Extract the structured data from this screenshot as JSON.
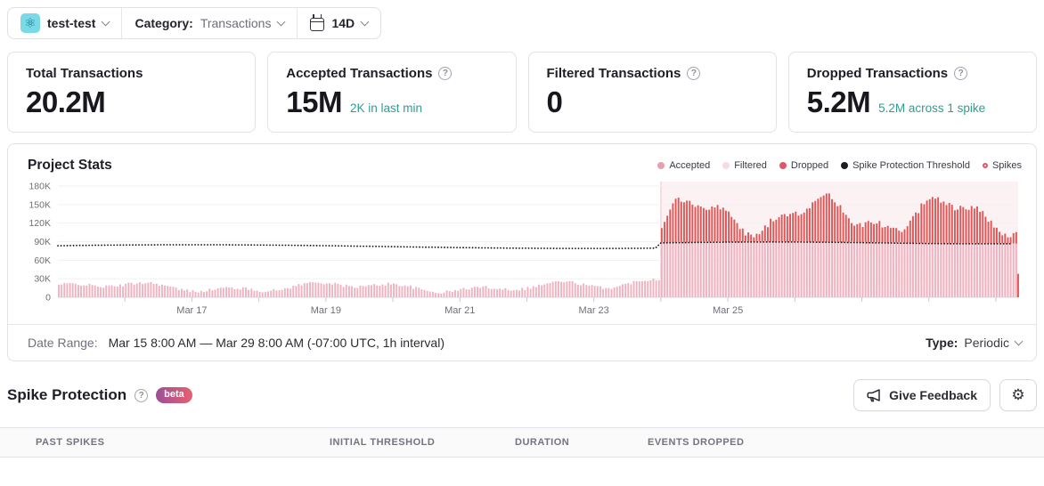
{
  "topbar": {
    "project_name": "test-test",
    "project_icon": "react-atom-icon",
    "category_label": "Category:",
    "category_value": "Transactions",
    "period": "14D"
  },
  "stat_cards": [
    {
      "title": "Total Transactions",
      "has_help": false,
      "value": "20.2M",
      "sub": ""
    },
    {
      "title": "Accepted Transactions",
      "has_help": true,
      "value": "15M",
      "sub": "2K in last min"
    },
    {
      "title": "Filtered Transactions",
      "has_help": true,
      "value": "0",
      "sub": ""
    },
    {
      "title": "Dropped Transactions",
      "has_help": true,
      "value": "5.2M",
      "sub": "5.2M across 1 spike"
    }
  ],
  "chart": {
    "title": "Project Stats",
    "legend": [
      {
        "label": "Accepted",
        "color": "#e7a0b0",
        "style": "dot"
      },
      {
        "label": "Filtered",
        "color": "#f3dce2",
        "style": "dot"
      },
      {
        "label": "Dropped",
        "color": "#e0566b",
        "style": "dot"
      },
      {
        "label": "Spike Protection Threshold",
        "color": "#1d1d24",
        "style": "dot"
      },
      {
        "label": "Spikes",
        "color": "#e0566b",
        "style": "ring"
      }
    ]
  },
  "chart_data": {
    "type": "bar",
    "stacked": true,
    "title": "Project Stats",
    "x_start": "Mar 15 8:00 AM",
    "x_end": "Mar 29 8:00 AM",
    "interval": "1h",
    "x_tick_labels": [
      "Mar 17",
      "Mar 19",
      "Mar 21",
      "Mar 23",
      "Mar 25"
    ],
    "x_tick_days": [
      2,
      4,
      6,
      8,
      10
    ],
    "n_day_ticks": 14,
    "y_tick_labels": [
      "0",
      "30K",
      "60K",
      "90K",
      "120K",
      "150K",
      "180K"
    ],
    "y_tick_values": [
      0,
      30,
      60,
      90,
      120,
      150,
      180
    ],
    "unit": "K",
    "ylim": [
      0,
      180
    ],
    "series": [
      {
        "name": "Accepted",
        "color": "#efb2c0",
        "summary": "pre-spike hourly volume 6-40K; during spike capped at threshold ~88K"
      },
      {
        "name": "Filtered",
        "color": "#f3dce2",
        "summary": "zero across range"
      },
      {
        "name": "Dropped",
        "color": "#e05555",
        "summary": "zero pre-spike; during spike stacks above threshold to totals 97-172K"
      }
    ],
    "threshold": {
      "name": "Spike Protection Threshold",
      "color": "#17171d",
      "pre_spike_level": 82,
      "during_spike_level": 88
    },
    "spike_region": {
      "start_hour_index": 216,
      "start_label": "Mar 24",
      "end": "chart end",
      "fill": "rgba(224,86,107,0.08)",
      "edge": "rgba(224,86,107,0.35)"
    },
    "gen": {
      "seed": 42,
      "n": 344,
      "spike_start_index": 216,
      "pre_base": 14,
      "pre_min": 5,
      "pre_max": 46,
      "spike_top_base": 128,
      "spike_top_min": 97,
      "spike_top_max": 172,
      "last_partial_dropped": 38
    }
  },
  "date_range": {
    "label": "Date Range:",
    "value": "Mar 15 8:00 AM — Mar 29 8:00 AM (-07:00 UTC, 1h interval)",
    "type_label": "Type:",
    "type_value": "Periodic"
  },
  "spike_protection": {
    "title": "Spike Protection",
    "badge": "beta",
    "feedback_button": "Give Feedback"
  },
  "table": {
    "columns": [
      "Past Spikes",
      "Initial Threshold",
      "Duration",
      "Events Dropped"
    ]
  }
}
